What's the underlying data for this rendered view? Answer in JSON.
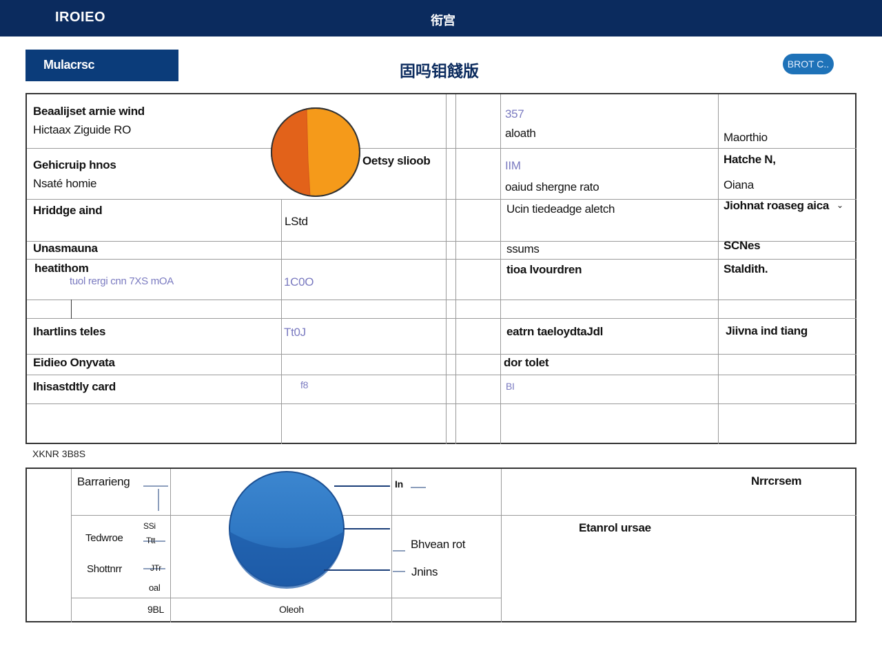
{
  "topbar": {
    "logo": "IROIEO",
    "center": "衔宫"
  },
  "header": {
    "tab": "Mulacrsc",
    "title": "固吗钼餞版",
    "pill": "BROT C.."
  },
  "table1": {
    "r1c1a": "Beaalijset arnie wind",
    "r1c1b": "Hictaax Ziguide RO",
    "r1c3a": "357",
    "r1c3b": "aloath",
    "r1c4": "Maorthio",
    "pie_label": "Oetsy slioob",
    "r2c1a": "Gehicruip hnos",
    "r2c1b": "Nsaté homie",
    "r2c3a": "IIM",
    "r2c3b": "oaiud shergne rato",
    "r2c4a": "Hatche N,",
    "r2c4b": "Oiana",
    "r3c1": "Hriddge aind",
    "r3c2": "LStd",
    "r3c3": "Ucin tiedeadge aletch",
    "r3c4": "Jiohnat roaseg aica",
    "r4c1": "Unasmauna",
    "r4c3": "ssums",
    "r4c4": "SCNes",
    "r5c1": "heatithom",
    "r5c1sub": "tuol rergi cnn 7XS mOA",
    "r5c2": "1C0O",
    "r5c3": "tioa lvourdren",
    "r5c4": "Staldith.",
    "r7c1": "Ihartlins teles",
    "r7c2": "Tt0J",
    "r7c3": "eatrn taeloydtaJdl",
    "r7c4": "Jiivna ind tiang",
    "r8c1": "Eidieo Onyvata",
    "r8c3": "dor tolet",
    "r9c1": "Ihisastdtly card",
    "r9c2": "f8",
    "r9c3": "BI"
  },
  "section_label": "XKNR 3B8S",
  "table2": {
    "r1c2": "Barrarieng",
    "r1c4": "In",
    "r1c6": "Nrrcrsem",
    "r2c2a": "Tedwroe",
    "r2c2b": "Shottnrr",
    "r2c3a": "SSi",
    "r2c3b": "Ttt",
    "r2c3c": "JTr",
    "r2c3d": "oal",
    "r2c4a": "Bhvean rot",
    "r2c4b": "Jnins",
    "r2c6": "Etanrol ursae",
    "r3c2": "9BL",
    "r3c3": "Oleoh"
  },
  "colors": {
    "topbar": "#0b2b5e",
    "tab": "#0b3c7a",
    "pill": "#1e72b8",
    "pie_orange_dark": "#e2621a",
    "pie_orange_light": "#f59a1a",
    "sphere_blue": "#2f78c4"
  }
}
